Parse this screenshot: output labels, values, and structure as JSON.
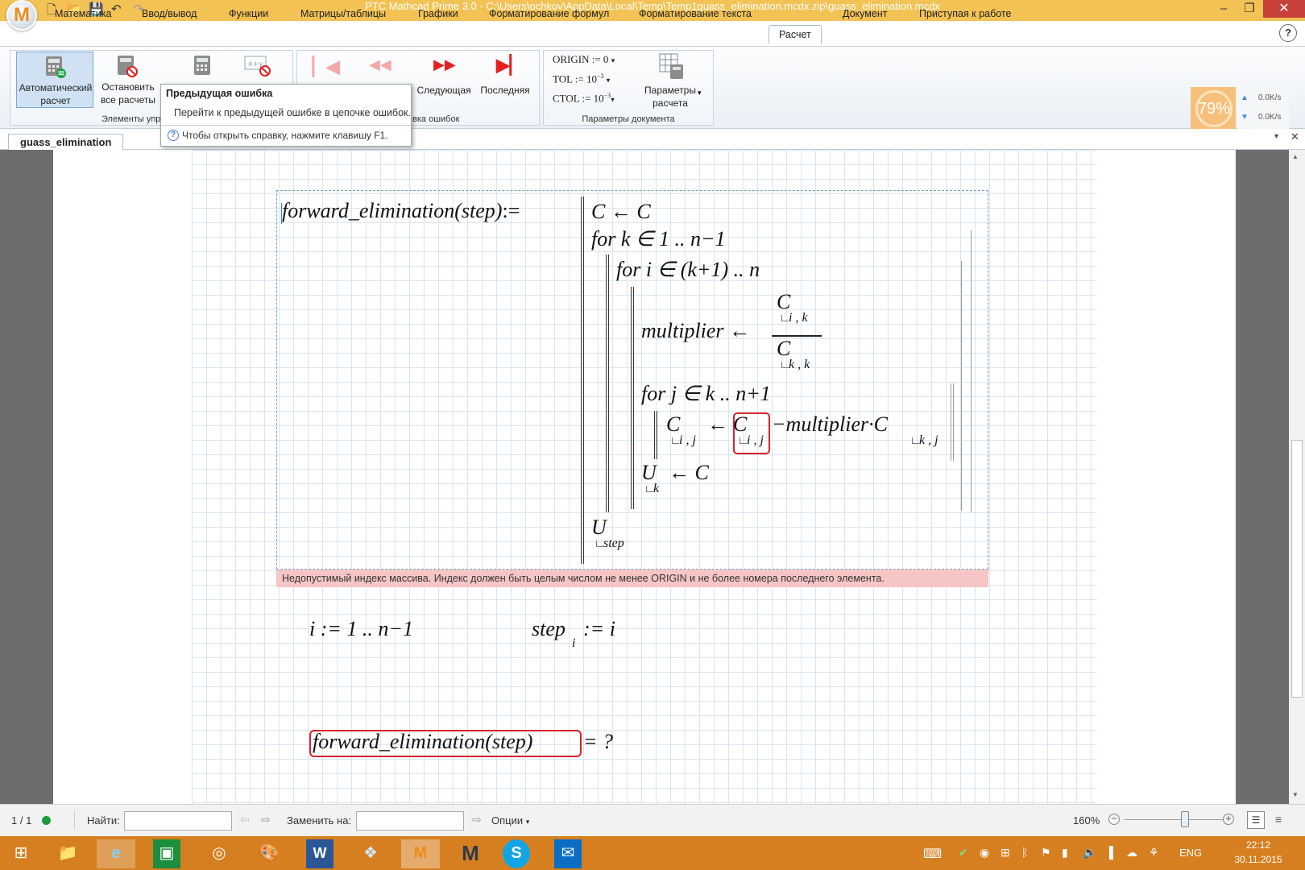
{
  "window": {
    "title": "PTC Mathcad Prime 3.0 - C:\\Users\\ochkov\\AppData\\Local\\Temp\\Temp1guass_elimination.mcdx.zip\\guass_elimination.mcdx",
    "logo_letter": "M"
  },
  "menu": {
    "tabs": [
      "Математика",
      "Ввод/вывод",
      "Функции",
      "Матрицы/таблицы",
      "Графики",
      "Форматирование формул",
      "Форматирование текста",
      "Расчет",
      "Документ",
      "Приступая к работе"
    ],
    "active_tab": "Расчет",
    "help_icon": "?"
  },
  "ribbon": {
    "auto_calc": "Автоматический расчет",
    "stop_calc": "Остановить все расчеты",
    "group_controls": "Элементы упр",
    "next": "Следующая",
    "last": "Последняя",
    "group_errors": "вка ошибок",
    "origin": "ORIGIN := 0",
    "tol": "TOL := 10",
    "tol_exp": "−3",
    "ctol": "CTOL := 10",
    "ctol_exp": "−3",
    "params_btn": "Параметры расчета",
    "group_doc": "Параметры документа",
    "cpu_percent": "79%",
    "net_up": "0.0K/s",
    "net_down": "0.0K/s"
  },
  "tooltip": {
    "title": "Предыдущая ошибка",
    "body": "Перейти к предыдущей ошибке в цепочке ошибок.",
    "help": "Чтобы открыть справку, нажмите клавишу F1."
  },
  "doc_tab": "guass_elimination",
  "math": {
    "func_def": "forward_elimination(step)",
    "assign": ":=",
    "l1": "C ← C",
    "l2": "for k ∈ 1 .. n−1",
    "l3": "for i ∈ (k+1) .. n",
    "l4_lhs": "multiplier ←",
    "frac_num": "C",
    "frac_num_sub": "i , k",
    "frac_den": "C",
    "frac_den_sub": "k , k",
    "l5": "for j ∈ k .. n+1",
    "l6_c": "C",
    "l6_c_sub": "i , j",
    "l6_arrow": "←",
    "l6_err_c": "C",
    "l6_err_sub": "i , j",
    "l6_rest": "−multiplier·C",
    "l6_rest_sub": "k , j",
    "l7": "U",
    "l7_sub": "k",
    "l7_rest": "← C",
    "l8": "U",
    "l8_sub": "step",
    "range_def": "i := 1 .. n−1",
    "step_def_lhs": "step",
    "step_def_sub": "i",
    "step_def_rhs": ":= i",
    "eval_expr": "forward_elimination(step)",
    "eval_rhs": "= ?"
  },
  "error_message": "Недопустимый индекс массива. Индекс должен быть целым числом не менее ORIGIN и не более номера последнего элемента.",
  "status": {
    "page": "1 / 1",
    "find_label": "Найти:",
    "replace_label": "Заменить на:",
    "options": "Опции",
    "zoom": "160%"
  },
  "taskbar": {
    "lang": "ENG",
    "time": "22:12",
    "date": "30.11.2015"
  },
  "colors": {
    "title_bar": "#f3c255",
    "taskbar": "#d67f20",
    "error_bg": "#f6c5c5",
    "error_box": "#d9232a",
    "close_btn": "#c8413a"
  }
}
